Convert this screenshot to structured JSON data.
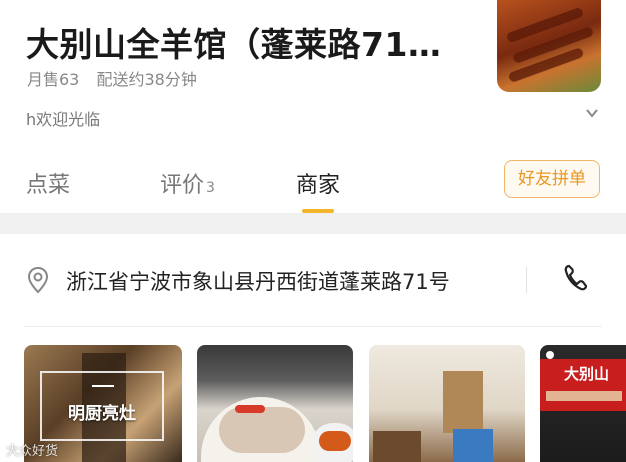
{
  "header": {
    "store_name": "大别山全羊馆（蓬莱路71…",
    "monthly_sales": "月售63",
    "delivery_time": "配送约38分钟",
    "notice": "h欢迎光临"
  },
  "tabs": [
    {
      "label": "点菜",
      "count": null,
      "active": false
    },
    {
      "label": "评价",
      "count": "3",
      "active": false
    },
    {
      "label": "商家",
      "count": null,
      "active": true
    }
  ],
  "share_button_label": "好友拼单",
  "merchant": {
    "address": "浙江省宁波市象山县丹西街道蓬莱路71号",
    "photos": [
      {
        "caption": "明厨亮灶"
      },
      {
        "caption": ""
      },
      {
        "caption": ""
      },
      {
        "caption": "大别山"
      }
    ]
  },
  "watermark": "大众好货",
  "colors": {
    "accent": "#f3b62b",
    "share_button_text": "#e8971f",
    "text_primary": "#222222",
    "text_secondary": "#888888"
  },
  "icons": [
    "location-pin-icon",
    "phone-icon",
    "chevron-down-icon"
  ]
}
